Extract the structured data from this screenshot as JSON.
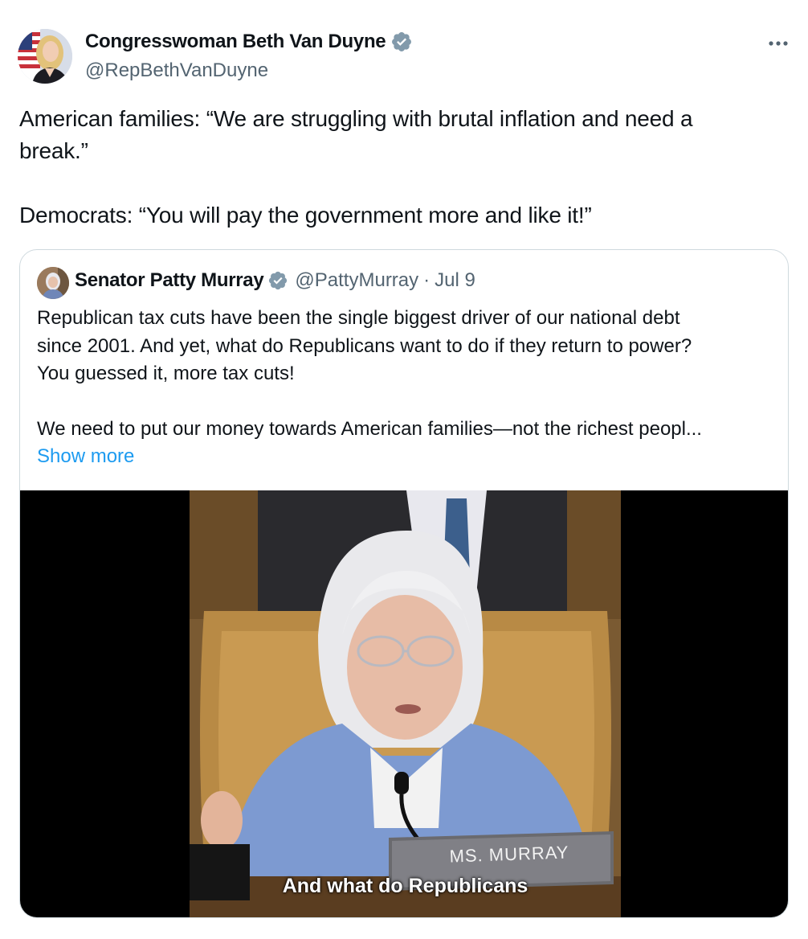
{
  "author": {
    "name": "Congresswoman Beth Van Duyne",
    "handle": "@RepBethVanDuyne",
    "verified": true
  },
  "tweet": {
    "line1": "American families: “We are struggling with brutal inflation and need a",
    "line2": "break.”",
    "line3": "Democrats: “You will pay the government more and like it!”"
  },
  "quoted": {
    "name": "Senator Patty Murray",
    "handle": "@PattyMurray",
    "separator": "·",
    "date": "Jul 9",
    "line1": "Republican tax cuts have been the single biggest driver of our national debt",
    "line2": "since 2001. And yet, what do Republicans want to do if they return to power?",
    "line3": "You guessed it, more tax cuts!",
    "line4": "We need to put our money towards American families—not the richest peopl...",
    "show_more": "Show more",
    "video": {
      "nameplate": "MS. MURRAY",
      "caption": "And what do Republicans"
    }
  },
  "colors": {
    "text": "#0f1419",
    "secondary": "#536471",
    "link": "#1d9bf0",
    "verified_badge": "#829aab",
    "border": "#cfd9de"
  },
  "icons": {
    "verified": "verified-badge-icon",
    "more": "more-options-icon"
  }
}
